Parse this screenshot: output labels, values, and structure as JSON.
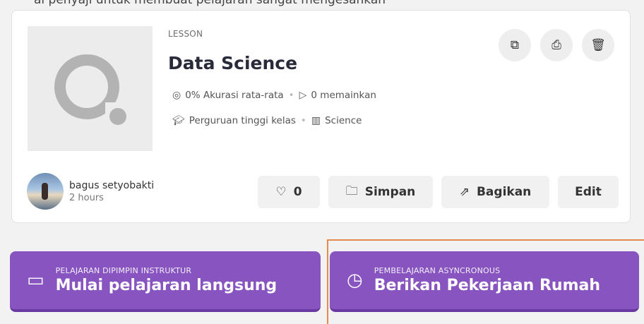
{
  "header_cut_text": "ai penyaji untuk membuat pelajaran sangat mengesankan",
  "quiz": {
    "tag": "LESSON",
    "title": "Data Science",
    "accuracy": "0% Akurasi rata-rata",
    "plays": "0 memainkan",
    "grade": "Perguruan tinggi kelas",
    "subject": "Science"
  },
  "icons": {
    "accuracy": "target-icon",
    "plays": "play-icon",
    "grade": "graduation-cap-icon",
    "subject": "books-icon",
    "copy": "copy-icon",
    "print": "print-icon",
    "delete": "trash-icon",
    "like": "heart-icon",
    "save": "folder-icon",
    "share": "share-icon",
    "live": "presentation-icon",
    "async": "clock-icon"
  },
  "author": {
    "name": "bagus setyobakti",
    "time": "2 hours"
  },
  "buttons": {
    "likes": "0",
    "save": "Simpan",
    "share": "Bagikan",
    "edit": "Edit"
  },
  "cta_live": {
    "small": "PELAJARAN DIPIMPIN INSTRUKTUR",
    "big": "Mulai pelajaran langsung"
  },
  "cta_async": {
    "small": "PEMBELAJARAN ASYNCRONOUS",
    "big": "Berikan Pekerjaan Rumah"
  },
  "colors": {
    "accent": "#8854c0",
    "highlight": "#e58a4b"
  }
}
